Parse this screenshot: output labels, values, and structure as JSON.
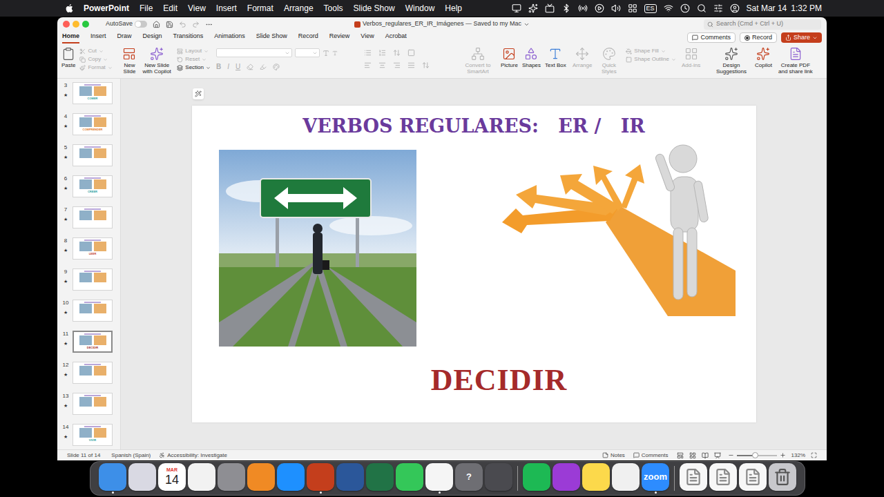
{
  "menubar": {
    "app": "PowerPoint",
    "items": [
      "File",
      "Edit",
      "View",
      "Insert",
      "Format",
      "Arrange",
      "Tools",
      "Slide Show",
      "Window",
      "Help"
    ],
    "input_source": "ES",
    "date": "Sat Mar 14",
    "time": "1:32 PM"
  },
  "window": {
    "title": "Verbos_regulares_ER_IR_Imágenes — Saved to my Mac",
    "autosave": {
      "label": "AutoSave",
      "on": false
    },
    "search": {
      "placeholder": "Search (Cmd + Ctrl + U)"
    }
  },
  "tabs": [
    {
      "label": "Home",
      "selected": true
    },
    {
      "label": "Insert",
      "selected": false
    },
    {
      "label": "Draw",
      "selected": false
    },
    {
      "label": "Design",
      "selected": false
    },
    {
      "label": "Transitions",
      "selected": false
    },
    {
      "label": "Animations",
      "selected": false
    },
    {
      "label": "Slide Show",
      "selected": false
    },
    {
      "label": "Record",
      "selected": false
    },
    {
      "label": "Review",
      "selected": false
    },
    {
      "label": "View",
      "selected": false
    },
    {
      "label": "Acrobat",
      "selected": false
    }
  ],
  "header_buttons": [
    {
      "label": "Comments",
      "kind": "comments"
    },
    {
      "label": "Record",
      "kind": "record"
    },
    {
      "label": "Share",
      "kind": "share"
    }
  ],
  "ribbon": [
    {
      "kind": "buttons",
      "items": [
        {
          "label": "Paste",
          "kind": "large",
          "disabled": false
        },
        {
          "label": "Cut",
          "kind": "small",
          "disabled": true
        },
        {
          "label": "Copy",
          "kind": "small",
          "disabled": true
        },
        {
          "label": "Format",
          "kind": "small",
          "disabled": true
        }
      ]
    },
    {
      "kind": "buttons",
      "items": [
        {
          "label": "New Slide",
          "kind": "large",
          "disabled": false
        },
        {
          "label": "New Slide with Copilot",
          "kind": "large",
          "disabled": false
        },
        {
          "label": "Layout",
          "kind": "small",
          "disabled": true
        },
        {
          "label": "Reset",
          "kind": "small",
          "disabled": true
        },
        {
          "label": "Section",
          "kind": "small",
          "disabled": false
        }
      ]
    },
    {
      "kind": "font",
      "disabled": true,
      "letters": [
        "B",
        "I",
        "U"
      ]
    },
    {
      "kind": "paragraph",
      "disabled": true
    },
    {
      "kind": "buttons",
      "items": [
        {
          "label": "Convert to SmartArt",
          "kind": "large",
          "disabled": true
        }
      ]
    },
    {
      "kind": "buttons",
      "items": [
        {
          "label": "Picture",
          "kind": "large",
          "disabled": false
        },
        {
          "label": "Shapes",
          "kind": "large",
          "disabled": false
        },
        {
          "label": "Text Box",
          "kind": "large",
          "disabled": false
        }
      ]
    },
    {
      "kind": "buttons",
      "items": [
        {
          "label": "Arrange",
          "kind": "large",
          "disabled": true
        },
        {
          "label": "Quick Styles",
          "kind": "large",
          "disabled": true
        },
        {
          "label": "Shape Fill",
          "kind": "small",
          "disabled": true
        },
        {
          "label": "Shape Outline",
          "kind": "small",
          "disabled": true
        }
      ]
    },
    {
      "kind": "buttons",
      "items": [
        {
          "label": "Add-ins",
          "kind": "large",
          "disabled": true
        }
      ]
    },
    {
      "kind": "buttons",
      "items": [
        {
          "label": "Design Suggestions",
          "kind": "large",
          "disabled": false
        },
        {
          "label": "Copilot",
          "kind": "large",
          "disabled": false
        },
        {
          "label": "Create PDF and share link",
          "kind": "large",
          "disabled": false
        }
      ]
    }
  ],
  "thumbnails": [
    {
      "number": "3",
      "mark": "★",
      "selected": false,
      "label": "COMER",
      "color": "#2a9d9d"
    },
    {
      "number": "4",
      "mark": "★",
      "selected": false,
      "label": "COMPRENDER",
      "color": "#e07a1f"
    },
    {
      "number": "5",
      "mark": "★",
      "selected": false
    },
    {
      "number": "6",
      "mark": "★",
      "selected": false,
      "label": "CREER",
      "color": "#2a9d9d"
    },
    {
      "number": "7",
      "mark": "★",
      "selected": false
    },
    {
      "number": "8",
      "mark": "★",
      "selected": false,
      "label": "LEER",
      "color": "#c0392b"
    },
    {
      "number": "9",
      "mark": "★",
      "selected": false
    },
    {
      "number": "10",
      "mark": "★",
      "selected": false
    },
    {
      "number": "11",
      "mark": "★",
      "selected": true,
      "label": "DECIDIR",
      "color": "#a52a2a"
    },
    {
      "number": "12",
      "mark": "★",
      "selected": false
    },
    {
      "number": "13",
      "mark": "★",
      "selected": false
    },
    {
      "number": "14",
      "mark": "★",
      "selected": false,
      "label": "VIVIR",
      "color": "#2a9d9d"
    }
  ],
  "slide": {
    "title": "VERBOS REGULARES:   ER /   IR",
    "word": "DECIDIR"
  },
  "status_bar": {
    "slide": "Slide 11 of 14",
    "language": "Spanish (Spain)",
    "accessibility": "Accessibility: Investigate",
    "notes": "Notes",
    "comments": "Comments",
    "zoom": "132%",
    "zoom_level": 0.45
  },
  "dock": [
    [
      {
        "kind": "plain",
        "color": "#3d8fe8",
        "running": true
      },
      {
        "kind": "plain",
        "color": "#d9d9e3",
        "running": false
      },
      {
        "kind": "calendar",
        "color": "#ffffff",
        "top": "MAR",
        "text": "14",
        "running": false
      },
      {
        "kind": "plain",
        "color": "#f2f2f2",
        "running": false
      },
      {
        "kind": "plain",
        "color": "#8e8e93",
        "running": false
      },
      {
        "kind": "plain",
        "color": "#f08a24",
        "running": false
      },
      {
        "kind": "plain",
        "color": "#1e90ff",
        "running": false
      },
      {
        "kind": "plain",
        "color": "#c43e1c",
        "running": true
      },
      {
        "kind": "plain",
        "color": "#2b579a",
        "running": false
      },
      {
        "kind": "plain",
        "color": "#217346",
        "running": false
      },
      {
        "kind": "plain",
        "color": "#34c759",
        "running": false
      },
      {
        "kind": "plain",
        "color": "#f5f5f5",
        "running": true
      },
      {
        "kind": "glyph",
        "color": "#6e6e73",
        "text": "?",
        "running": false
      },
      {
        "kind": "plain",
        "color": "#4a4a4f",
        "running": false
      }
    ],
    [
      {
        "kind": "plain",
        "color": "#1db954",
        "running": false
      },
      {
        "kind": "plain",
        "color": "#9b3bd6",
        "running": false
      },
      {
        "kind": "plain",
        "color": "#fcd94b",
        "running": false
      },
      {
        "kind": "plain",
        "color": "#f0f0f0",
        "running": false
      },
      {
        "kind": "glyph",
        "color": "#2d8cff",
        "text": "zoom",
        "running": true
      }
    ],
    [
      {
        "kind": "doc",
        "color": "#f7f7f7",
        "running": false
      },
      {
        "kind": "doc",
        "color": "#f7f7f7",
        "running": false
      },
      {
        "kind": "doc",
        "color": "#f7f7f7",
        "running": false
      },
      {
        "kind": "trash",
        "color": "#c8c8cc",
        "running": false
      }
    ]
  ]
}
